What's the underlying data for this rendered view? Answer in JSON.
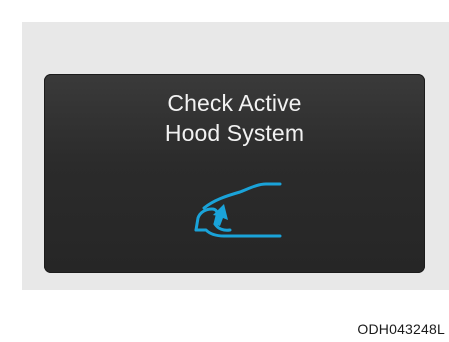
{
  "display": {
    "line1": "Check Active",
    "line2": "Hood System",
    "icon": "active-hood-warning-icon",
    "icon_color": "#1aa3d9"
  },
  "image_code": "ODH043248L"
}
